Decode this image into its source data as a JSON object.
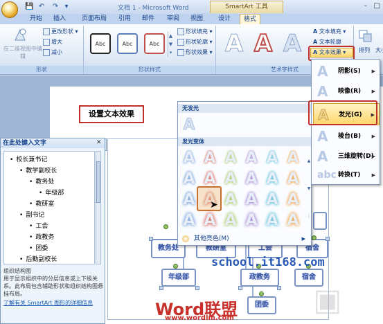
{
  "title_bar": {
    "title": "文档 1 - Microsoft Word",
    "context_tab_group": "SmartArt 工具"
  },
  "tabs": [
    "开始",
    "插入",
    "页面布局",
    "引用",
    "邮件",
    "审阅",
    "视图",
    "设计",
    "格式"
  ],
  "active_tab": "格式",
  "ribbon": {
    "shapes_group": {
      "label": "形状",
      "edit_2d_label": "在二维视图中编辑",
      "change_shape": "更改形状",
      "larger": "增大",
      "smaller": "减小"
    },
    "shape_styles_group": {
      "label": "形状样式",
      "sample_text": "Abc",
      "fill": "形状填充",
      "outline": "形状轮廓",
      "effects": "形状效果"
    },
    "wordart_group": {
      "label": "艺术字样式",
      "text_fill": "文本填充",
      "text_outline": "文本轮廓",
      "text_effects": "文本效果"
    },
    "arrange_label": "排列",
    "size_label": "大小"
  },
  "effect_menu": {
    "items": [
      {
        "label": "阴影(S)"
      },
      {
        "label": "映像(R)"
      },
      {
        "label": "发光(G)"
      },
      {
        "label": "棱台(B)"
      },
      {
        "label": "三维旋转(D)"
      },
      {
        "label": "转换(T)"
      }
    ],
    "highlighted": "发光(G)"
  },
  "glow_gallery": {
    "no_glow_header": "无发光",
    "variants_header": "发光变体",
    "more_colors": "其他亮色(M)",
    "glow_colors": [
      "#7aa3d8",
      "#d96b5f",
      "#a8c864",
      "#a88ad0",
      "#5cc0d8",
      "#f0a44a"
    ]
  },
  "callout": "设置文本效果",
  "text_pane": {
    "header": "在此处键入文字",
    "items": [
      {
        "text": "校长兼书记",
        "level": 0
      },
      {
        "text": "教学副校长",
        "level": 1
      },
      {
        "text": "教务处",
        "level": 2
      },
      {
        "text": "年级部",
        "level": 3
      },
      {
        "text": "教研室",
        "level": 2
      },
      {
        "text": "副书记",
        "level": 1
      },
      {
        "text": "工会",
        "level": 2
      },
      {
        "text": "政教务",
        "level": 2
      },
      {
        "text": "团委",
        "level": 2
      },
      {
        "text": "后勤副校长",
        "level": 1
      }
    ],
    "desc_title": "组织结构图",
    "desc": "用于显示组织中的分层信息或上下级关系。此布局包含辅助形状和组织结构图悬挂布局。",
    "link": "了解有关 SmartArt 图形的详细信息"
  },
  "smartart_nodes": {
    "n1": "教务处",
    "n2": "教研室",
    "n3": "工会",
    "n4": "宿舍",
    "n5": "年级部",
    "n6": "政教务",
    "n7": "宿舍",
    "n8": "团委"
  },
  "watermarks": {
    "school": "school.it168.com",
    "logo": "Word联盟",
    "logo_url": "www.wordlm.com"
  }
}
